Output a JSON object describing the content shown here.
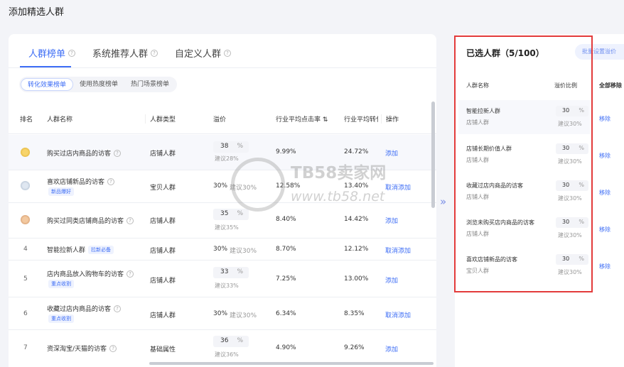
{
  "page_title": "添加精选人群",
  "tabs": [
    {
      "label": "人群榜单",
      "active": true
    },
    {
      "label": "系统推荐人群",
      "active": false
    },
    {
      "label": "自定义人群",
      "active": false
    }
  ],
  "subtabs": [
    {
      "label": "转化效果榜单",
      "active": true
    },
    {
      "label": "使用热度榜单",
      "active": false
    },
    {
      "label": "热门场景榜单",
      "active": false
    }
  ],
  "table": {
    "headers": [
      "排名",
      "人群名称",
      "人群类型",
      "溢价",
      "行业平均点击率",
      "行业平均转化",
      "操作"
    ],
    "rows": [
      {
        "rank": "",
        "medal": "gold",
        "name": "购买过店内商品的访客",
        "tag": "",
        "type": "店铺人群",
        "bid": "38",
        "bid_suffix": "%",
        "suggest": "建议28%",
        "ctr": "9.99%",
        "cvr": "24.72%",
        "action": "添加"
      },
      {
        "rank": "",
        "medal": "silver",
        "name": "喜欢店铺新品的访客",
        "tag": "新品爆好",
        "type": "宝贝人群",
        "bid": "30%",
        "suggest": "建议30%",
        "ctr": "12.58%",
        "cvr": "13.40%",
        "action": "取消添加"
      },
      {
        "rank": "",
        "medal": "bronze",
        "name": "购买过同类店铺商品的访客",
        "tag": "",
        "type": "店铺人群",
        "bid": "35",
        "bid_suffix": "%",
        "suggest": "建议35%",
        "ctr": "8.40%",
        "cvr": "14.42%",
        "action": "添加"
      },
      {
        "rank": "4",
        "medal": "",
        "name": "智能拉新人群",
        "tag": "拉新必备",
        "type": "店铺人群",
        "bid": "30%",
        "suggest": "建议30%",
        "ctr": "8.70%",
        "cvr": "12.12%",
        "action": "取消添加"
      },
      {
        "rank": "5",
        "medal": "",
        "name": "店内商品放入购物车的访客",
        "tag": "重点收割",
        "type": "店铺人群",
        "bid": "33",
        "bid_suffix": "%",
        "suggest": "建议33%",
        "ctr": "7.25%",
        "cvr": "13.00%",
        "action": "添加"
      },
      {
        "rank": "6",
        "medal": "",
        "name": "收藏过店内商品的访客",
        "tag": "重点收割",
        "type": "店铺人群",
        "bid": "30%",
        "suggest": "建议30%",
        "ctr": "6.34%",
        "cvr": "8.35%",
        "action": "取消添加"
      },
      {
        "rank": "7",
        "medal": "",
        "name": "资深淘宝/天猫的访客",
        "tag": "",
        "type": "基础属性",
        "bid": "36",
        "bid_suffix": "%",
        "suggest": "建议36%",
        "ctr": "4.90%",
        "cvr": "9.26%",
        "action": "添加"
      }
    ]
  },
  "selected": {
    "title": "已选人群（5/100）",
    "batch_label": "批量设置溢价",
    "headers": [
      "人群名称",
      "溢价比例",
      "全部移除"
    ],
    "items": [
      {
        "name": "智能拉新人群",
        "type": "店铺人群",
        "bid": "30",
        "suffix": "%",
        "suggest": "建议30%",
        "remove": "移除"
      },
      {
        "name": "店铺长期价值人群",
        "type": "店铺人群",
        "bid": "30",
        "suffix": "%",
        "suggest": "建议30%",
        "remove": "移除"
      },
      {
        "name": "收藏过店内商品的访客",
        "type": "店铺人群",
        "bid": "30",
        "suffix": "%",
        "suggest": "建议30%",
        "remove": "移除"
      },
      {
        "name": "浏览未购买店内商品的访客",
        "type": "店铺人群",
        "bid": "30",
        "suffix": "%",
        "suggest": "建议30%",
        "remove": "移除"
      },
      {
        "name": "喜欢店铺新品的访客",
        "type": "宝贝人群",
        "bid": "30",
        "suffix": "%",
        "suggest": "建议30%",
        "remove": "移除"
      }
    ]
  },
  "watermark": {
    "line1": "TB58卖家网",
    "line2": "www.tb58.net"
  }
}
